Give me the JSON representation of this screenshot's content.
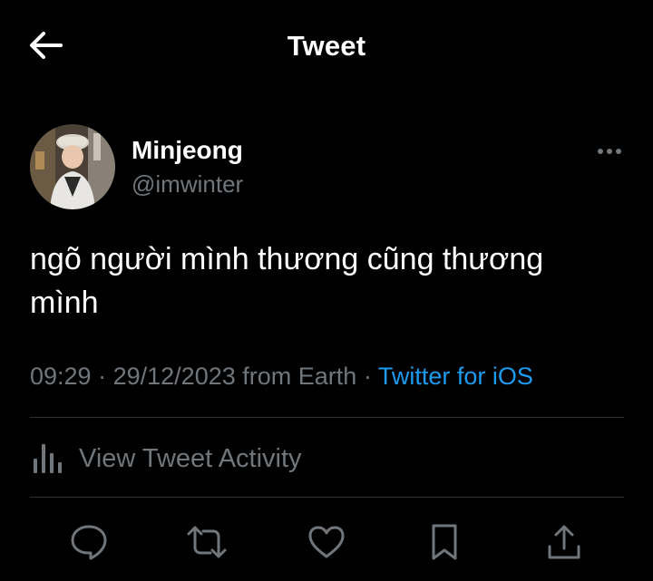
{
  "header": {
    "title": "Tweet",
    "back_icon": "arrow-left-icon"
  },
  "author": {
    "display_name": "Minjeong",
    "handle": "@imwinter",
    "more_icon": "more-horizontal-icon"
  },
  "tweet": {
    "text": "ngõ người mình thương cũng thương mình"
  },
  "meta": {
    "time": "09:29",
    "separator": "·",
    "date": "29/12/2023",
    "from_text": "from Earth",
    "source": "Twitter for iOS"
  },
  "activity": {
    "label": "View Tweet Activity",
    "icon": "bar-chart-icon"
  },
  "actions": [
    {
      "name": "reply",
      "icon": "reply-bubble-icon"
    },
    {
      "name": "retweet",
      "icon": "retweet-icon"
    },
    {
      "name": "like",
      "icon": "heart-icon"
    },
    {
      "name": "bookmark",
      "icon": "bookmark-icon"
    },
    {
      "name": "share",
      "icon": "share-upload-icon"
    }
  ],
  "colors": {
    "background": "#000000",
    "primary_text": "#ffffff",
    "secondary_text": "#71767b",
    "accent": "#1d9bf0",
    "divider": "#2f3336"
  }
}
